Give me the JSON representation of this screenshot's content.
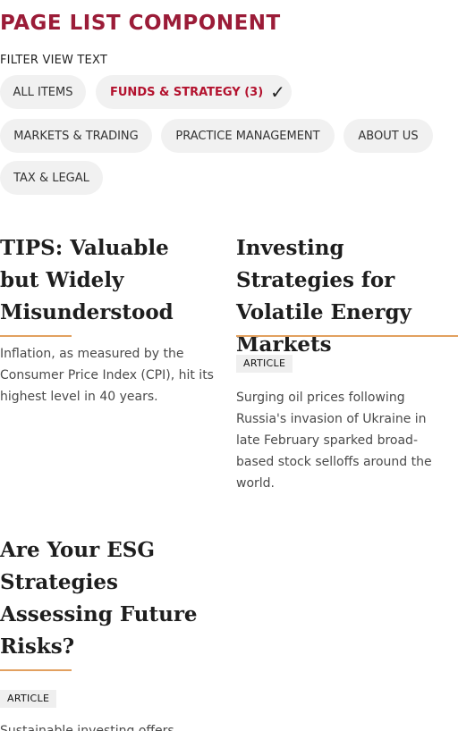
{
  "page": {
    "title": "PAGE LIST COMPONENT"
  },
  "filters": {
    "label": "FILTER VIEW TEXT",
    "chips": [
      {
        "label": "ALL ITEMS",
        "active": false
      },
      {
        "label": "FUNDS & STRATEGY (3)",
        "active": true
      },
      {
        "label": "MARKETS & TRADING",
        "active": false
      },
      {
        "label": "PRACTICE MANAGEMENT",
        "active": false
      },
      {
        "label": "ABOUT US",
        "active": false
      },
      {
        "label": "TAX & LEGAL",
        "active": false
      }
    ],
    "check_glyph": "✓"
  },
  "cards": [
    {
      "title": "TIPS: Valuable but Widely Misunderstood",
      "badge": "",
      "description": "Inflation, as measured by the Consumer Price Index (CPI), hit its highest level in 40 years."
    },
    {
      "title": "Investing Strategies for Volatile Energy Markets",
      "badge": "ARTICLE",
      "description": "Surging oil prices following Russia's invasion of Ukraine in late February sparked broad-based stock selloffs around the world."
    },
    {
      "title": "Are Your ESG Strategies Assessing Future Risks?",
      "badge": "ARTICLE",
      "description": "Sustainable investing offers"
    }
  ],
  "colors": {
    "brand": "#9b1c38",
    "active_chip_text": "#b3122e",
    "accent_rule": "#e2a05f",
    "chip_bg": "#f1f1f1"
  }
}
